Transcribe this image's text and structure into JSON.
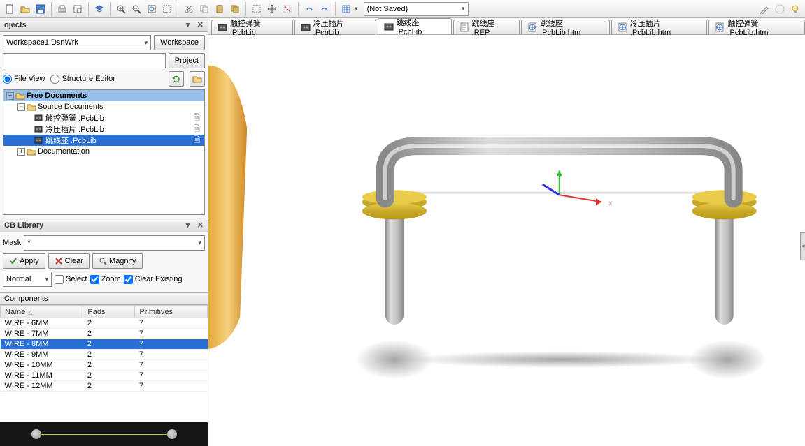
{
  "toolbar": {
    "filter_value": "(Not Saved)"
  },
  "panels": {
    "projects_title": "ojects",
    "pcblib_title": "CB Library"
  },
  "projects": {
    "workspace_value": "Workspace1.DsnWrk",
    "workspace_btn": "Workspace",
    "project_btn": "Project",
    "file_view": "File View",
    "structure_editor": "Structure Editor",
    "tree": {
      "root": "Free Documents",
      "source": "Source Documents",
      "docs": [
        "触控弹簧 .PcbLib",
        "冷压插片 .PcbLib",
        "跳线座 .PcbLib"
      ],
      "documentation": "Documentation"
    }
  },
  "pcblib": {
    "mask_label": "Mask",
    "mask_value": "*",
    "apply": "Apply",
    "clear": "Clear",
    "magnify": "Magnify",
    "mode": "Normal",
    "select": "Select",
    "zoom": "Zoom",
    "clear_existing": "Clear Existing",
    "components_title": "Components",
    "col_name": "Name",
    "col_pads": "Pads",
    "col_primitives": "Primitives",
    "rows": [
      {
        "name": "WIRE - 6MM",
        "pads": "2",
        "prim": "7"
      },
      {
        "name": "WIRE - 7MM",
        "pads": "2",
        "prim": "7"
      },
      {
        "name": "WIRE - 8MM",
        "pads": "2",
        "prim": "7"
      },
      {
        "name": "WIRE - 9MM",
        "pads": "2",
        "prim": "7"
      },
      {
        "name": "WIRE - 10MM",
        "pads": "2",
        "prim": "7"
      },
      {
        "name": "WIRE - 11MM",
        "pads": "2",
        "prim": "7"
      },
      {
        "name": "WIRE - 12MM",
        "pads": "2",
        "prim": "7"
      }
    ],
    "selected_index": 2
  },
  "tabs": [
    {
      "label": "触控弹簧 .PcbLib",
      "icon": "pcb"
    },
    {
      "label": "冷压插片 .PcbLib",
      "icon": "pcb"
    },
    {
      "label": "跳线座 .PcbLib",
      "icon": "pcb",
      "active": true
    },
    {
      "label": "跳线座 .REP",
      "icon": "txt"
    },
    {
      "label": "跳线座 .PcbLib.htm",
      "icon": "htm"
    },
    {
      "label": "冷压插片 .PcbLib.htm",
      "icon": "htm"
    },
    {
      "label": "触控弹簧 .PcbLib.htm",
      "icon": "htm"
    }
  ]
}
